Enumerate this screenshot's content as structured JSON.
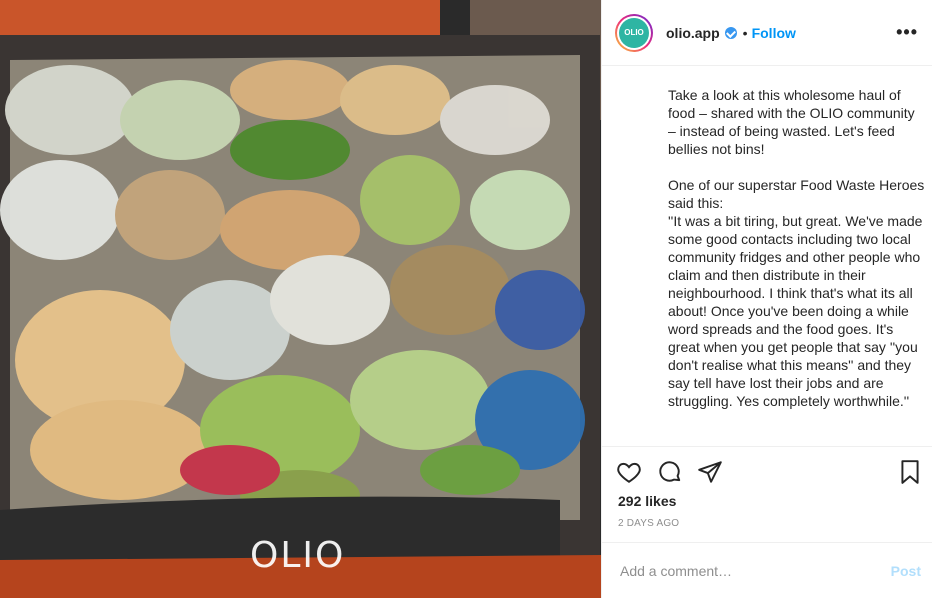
{
  "post": {
    "username": "olio.app",
    "follow_label": "Follow",
    "dot": "•",
    "more_label": "•••",
    "avatar_text": "OLIO",
    "caption": "Take a look at this wholesome haul of food – shared with the OLIO community – instead of being wasted. Let's feed bellies not bins!\n\nOne of our superstar Food Waste Heroes said this:\n''It was a bit tiring, but great. We've made some good contacts including two local community fridges and other people who claim and then distribute in their neighbourhood. I think that's what its all about! Once you've been doing a while word spreads and the food goes. It's great when you get people that say ''you don't realise what this means'' and they say tell have lost their jobs and are struggling. Yes completely worthwhile.''",
    "likes": "292 likes",
    "date": "2 DAYS AGO",
    "comment_placeholder": "Add a comment…",
    "post_label": "Post"
  },
  "photo": {
    "watermark": "OLIO",
    "description_icons": [
      "heart-icon",
      "comment-icon",
      "share-icon",
      "bookmark-icon"
    ]
  },
  "colors": {
    "accent": "#0095f6",
    "verified": "#3897f0",
    "brand": "#2eb5a3",
    "car": "#b8431c"
  }
}
